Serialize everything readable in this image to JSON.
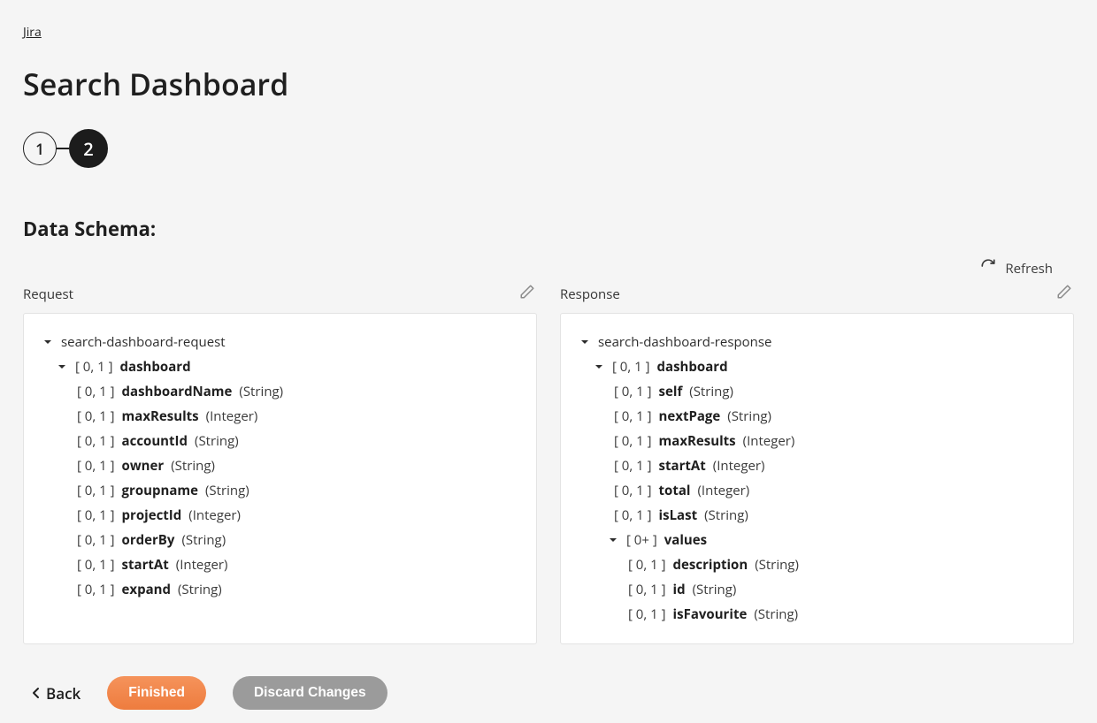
{
  "breadcrumb": "Jira",
  "title": "Search Dashboard",
  "steps": [
    "1",
    "2"
  ],
  "section_heading": "Data Schema:",
  "refresh_label": "Refresh",
  "panels": {
    "request": {
      "label": "Request"
    },
    "response": {
      "label": "Response"
    }
  },
  "request_tree": {
    "root": "search-dashboard-request",
    "group": {
      "card": "[ 0, 1 ]",
      "name": "dashboard"
    },
    "fields": [
      {
        "card": "[ 0, 1 ]",
        "name": "dashboardName",
        "type": "(String)"
      },
      {
        "card": "[ 0, 1 ]",
        "name": "maxResults",
        "type": "(Integer)"
      },
      {
        "card": "[ 0, 1 ]",
        "name": "accountId",
        "type": "(String)"
      },
      {
        "card": "[ 0, 1 ]",
        "name": "owner",
        "type": "(String)"
      },
      {
        "card": "[ 0, 1 ]",
        "name": "groupname",
        "type": "(String)"
      },
      {
        "card": "[ 0, 1 ]",
        "name": "projectId",
        "type": "(Integer)"
      },
      {
        "card": "[ 0, 1 ]",
        "name": "orderBy",
        "type": "(String)"
      },
      {
        "card": "[ 0, 1 ]",
        "name": "startAt",
        "type": "(Integer)"
      },
      {
        "card": "[ 0, 1 ]",
        "name": "expand",
        "type": "(String)"
      }
    ]
  },
  "response_tree": {
    "root": "search-dashboard-response",
    "group": {
      "card": "[ 0, 1 ]",
      "name": "dashboard"
    },
    "fields_a": [
      {
        "card": "[ 0, 1 ]",
        "name": "self",
        "type": "(String)"
      },
      {
        "card": "[ 0, 1 ]",
        "name": "nextPage",
        "type": "(String)"
      },
      {
        "card": "[ 0, 1 ]",
        "name": "maxResults",
        "type": "(Integer)"
      },
      {
        "card": "[ 0, 1 ]",
        "name": "startAt",
        "type": "(Integer)"
      },
      {
        "card": "[ 0, 1 ]",
        "name": "total",
        "type": "(Integer)"
      },
      {
        "card": "[ 0, 1 ]",
        "name": "isLast",
        "type": "(String)"
      }
    ],
    "group_b": {
      "card": "[ 0+ ]",
      "name": "values"
    },
    "fields_b": [
      {
        "card": "[ 0, 1 ]",
        "name": "description",
        "type": "(String)"
      },
      {
        "card": "[ 0, 1 ]",
        "name": "id",
        "type": "(String)"
      },
      {
        "card": "[ 0, 1 ]",
        "name": "isFavourite",
        "type": "(String)"
      }
    ]
  },
  "footer": {
    "back": "Back",
    "finished": "Finished",
    "discard": "Discard Changes"
  }
}
